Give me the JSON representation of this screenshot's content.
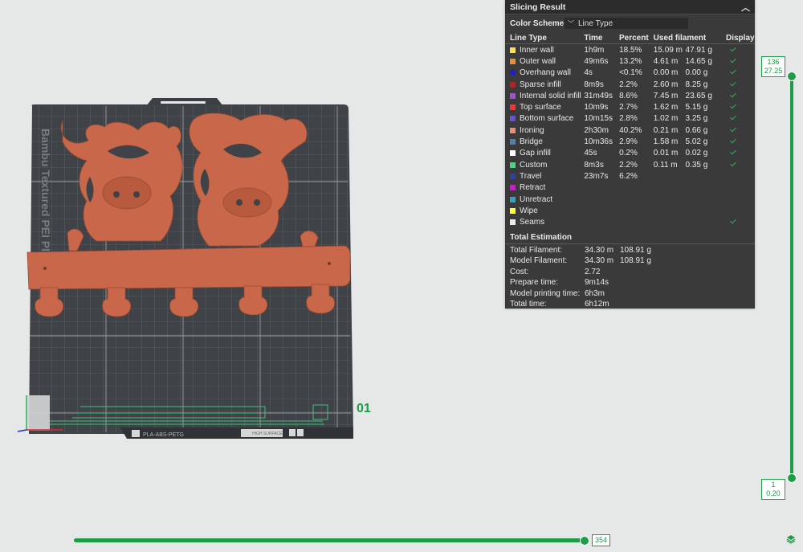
{
  "panel": {
    "title": "Slicing Result",
    "collapse_icon": "chevron-up-icon",
    "color_scheme_label": "Color Scheme",
    "color_scheme_value": "Line Type",
    "headers": [
      "Line Type",
      "Time",
      "Percent",
      "Used filament",
      "Display"
    ],
    "rows": [
      {
        "name": "Inner wall",
        "color": "#ffe04a",
        "time": "1h9m",
        "percent": "18.5%",
        "length": "15.09 m",
        "weight": "47.91 g",
        "display": true
      },
      {
        "name": "Outer wall",
        "color": "#f08a30",
        "time": "49m6s",
        "percent": "13.2%",
        "length": "4.61 m",
        "weight": "14.65 g",
        "display": true
      },
      {
        "name": "Overhang wall",
        "color": "#1e1ed6",
        "time": "4s",
        "percent": "<0.1%",
        "length": "0.00 m",
        "weight": "0.00 g",
        "display": true
      },
      {
        "name": "Sparse infill",
        "color": "#b22424",
        "time": "8m9s",
        "percent": "2.2%",
        "length": "2.60 m",
        "weight": "8.25 g",
        "display": true
      },
      {
        "name": "Internal solid infill",
        "color": "#9c54c8",
        "time": "31m49s",
        "percent": "8.6%",
        "length": "7.45 m",
        "weight": "23.65 g",
        "display": true
      },
      {
        "name": "Top surface",
        "color": "#e63838",
        "time": "10m9s",
        "percent": "2.7%",
        "length": "1.62 m",
        "weight": "5.15 g",
        "display": true
      },
      {
        "name": "Bottom surface",
        "color": "#6a52c8",
        "time": "10m15s",
        "percent": "2.8%",
        "length": "1.02 m",
        "weight": "3.25 g",
        "display": true
      },
      {
        "name": "Ironing",
        "color": "#f28a6c",
        "time": "2h30m",
        "percent": "40.2%",
        "length": "0.21 m",
        "weight": "0.66 g",
        "display": true
      },
      {
        "name": "Bridge",
        "color": "#4f7fb8",
        "time": "10m36s",
        "percent": "2.9%",
        "length": "1.58 m",
        "weight": "5.02 g",
        "display": true
      },
      {
        "name": "Gap infill",
        "color": "#ffffff",
        "time": "45s",
        "percent": "0.2%",
        "length": "0.01 m",
        "weight": "0.02 g",
        "display": true
      },
      {
        "name": "Custom",
        "color": "#4fcf8a",
        "time": "8m3s",
        "percent": "2.2%",
        "length": "0.11 m",
        "weight": "0.35 g",
        "display": true
      },
      {
        "name": "Travel",
        "color": "#33409a",
        "time": "23m7s",
        "percent": "6.2%",
        "length": "",
        "weight": "",
        "display": false
      },
      {
        "name": "Retract",
        "color": "#c81ec8",
        "time": "",
        "percent": "",
        "length": "",
        "weight": "",
        "display": false
      },
      {
        "name": "Unretract",
        "color": "#26a6c8",
        "time": "",
        "percent": "",
        "length": "",
        "weight": "",
        "display": false
      },
      {
        "name": "Wipe",
        "color": "#ffff2a",
        "time": "",
        "percent": "",
        "length": "",
        "weight": "",
        "display": false
      },
      {
        "name": "Seams",
        "color": "#ececec",
        "time": "",
        "percent": "",
        "length": "",
        "weight": "",
        "display": true
      }
    ],
    "total_title": "Total Estimation",
    "totals": [
      {
        "label": "Total Filament:",
        "v1": "34.30 m",
        "v2": "108.91 g"
      },
      {
        "label": "Model Filament:",
        "v1": "34.30 m",
        "v2": "108.91 g"
      },
      {
        "label": "Cost:",
        "v1": "2.72",
        "v2": ""
      },
      {
        "label": "Prepare time:",
        "v1": "9m14s",
        "v2": ""
      },
      {
        "label": "Model printing time:",
        "v1": "6h3m",
        "v2": ""
      },
      {
        "label": "Total time:",
        "v1": "6h12m",
        "v2": ""
      }
    ]
  },
  "layer_slider": {
    "top_layer": "136",
    "top_height": "27.25",
    "bottom_layer": "1",
    "bottom_height": "0.20",
    "accent": "#1f9c48"
  },
  "move_slider": {
    "value": "354"
  },
  "plate": {
    "number": "01",
    "bed_label": "Bambu Textured PEI Plate",
    "filament_label": "PLA-ABS-PETG",
    "surface_label": "HIGH SURFACE",
    "model_color": "#c8674a"
  }
}
